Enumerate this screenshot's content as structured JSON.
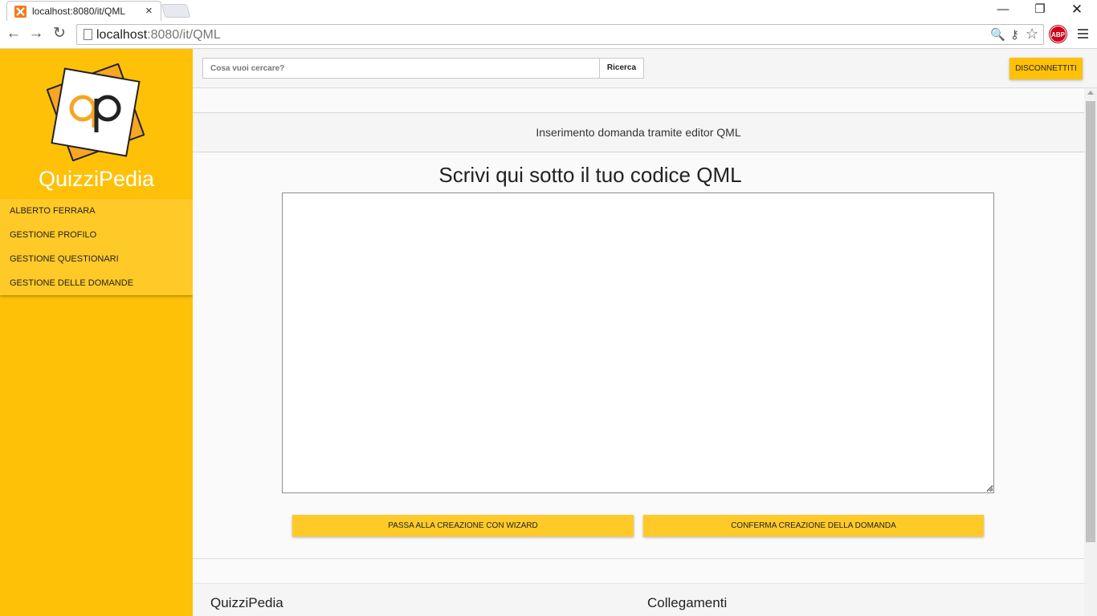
{
  "browser": {
    "tab_title": "localhost:8080/it/QML",
    "tab_close": "×",
    "url_host": "localhost",
    "url_rest": ":8080/it/QML",
    "window_controls": {
      "minimize": "—",
      "maximize": "❐",
      "close": "✕"
    },
    "nav": {
      "back": "←",
      "forward": "→",
      "reload": "↻"
    },
    "omnibox_icons": {
      "zoom": "🔍",
      "key": "⚷",
      "star": "☆"
    },
    "extension_label": "ABP"
  },
  "sidebar": {
    "brand": "QuizziPedia",
    "items": [
      {
        "label": "ALBERTO FERRARA"
      },
      {
        "label": "GESTIONE PROFILO"
      },
      {
        "label": "GESTIONE QUESTIONARI"
      },
      {
        "label": "GESTIONE DELLE DOMANDE"
      }
    ]
  },
  "topbar": {
    "search_placeholder": "Cosa vuoi cercare?",
    "search_button": "Ricerca",
    "logout_button": "DISCONNETTITI"
  },
  "main": {
    "subheader": "Inserimento domanda tramite editor QML",
    "heading": "Scrivi qui sotto il tuo codice QML",
    "editor_value": "",
    "wizard_button": "PASSA ALLA CREAZIONE CON WIZARD",
    "confirm_button": "CONFERMA CREAZIONE DELLA DOMANDA"
  },
  "footer": {
    "left_title": "QuizziPedia",
    "right_title": "Collegamenti"
  },
  "colors": {
    "accent": "#ffc107",
    "accent_light": "#ffca28",
    "favicon": "#f07a26",
    "abp_red": "#d0021b"
  }
}
